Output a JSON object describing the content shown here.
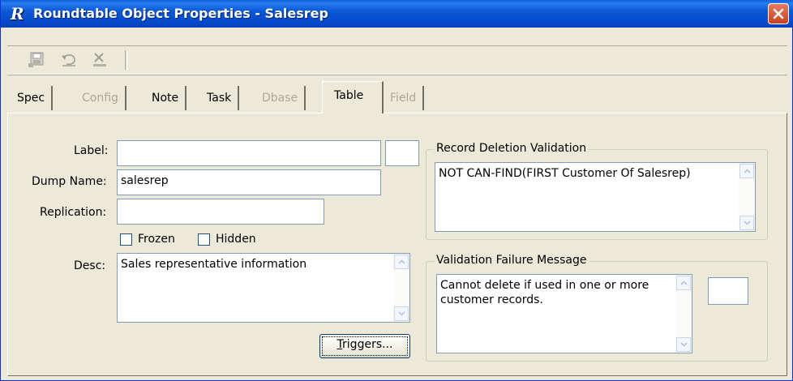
{
  "window": {
    "title": "Roundtable Object Properties - Salesrep",
    "app_icon_letter": "R"
  },
  "toolbar": {
    "buttons": [
      {
        "name": "save-icon",
        "enabled": false
      },
      {
        "name": "undo-icon",
        "enabled": false
      },
      {
        "name": "delete-icon",
        "enabled": false
      }
    ]
  },
  "tabs": [
    {
      "label": "Spec",
      "enabled": true,
      "active": false
    },
    {
      "label": "Config",
      "enabled": false,
      "active": false
    },
    {
      "label": "Note",
      "enabled": true,
      "active": false
    },
    {
      "label": "Task",
      "enabled": true,
      "active": false
    },
    {
      "label": "Dbase",
      "enabled": false,
      "active": false
    },
    {
      "label": "Table",
      "enabled": true,
      "active": true
    },
    {
      "label": "Field",
      "enabled": false,
      "active": false
    }
  ],
  "form": {
    "label_label": "Label:",
    "label_value": "",
    "dump_name_label": "Dump Name:",
    "dump_name_value": "salesrep",
    "replication_label": "Replication:",
    "replication_value": "",
    "frozen_label": "Frozen",
    "frozen_checked": false,
    "hidden_label": "Hidden",
    "hidden_checked": false,
    "desc_label": "Desc:",
    "desc_value": "Sales representative information",
    "triggers_button": "Triggers..."
  },
  "record_deletion": {
    "title": "Record Deletion Validation",
    "value": "NOT CAN-FIND(FIRST Customer Of Salesrep)"
  },
  "validation_failure": {
    "title": "Validation Failure Message",
    "value": "Cannot delete if used in one or more customer records."
  }
}
